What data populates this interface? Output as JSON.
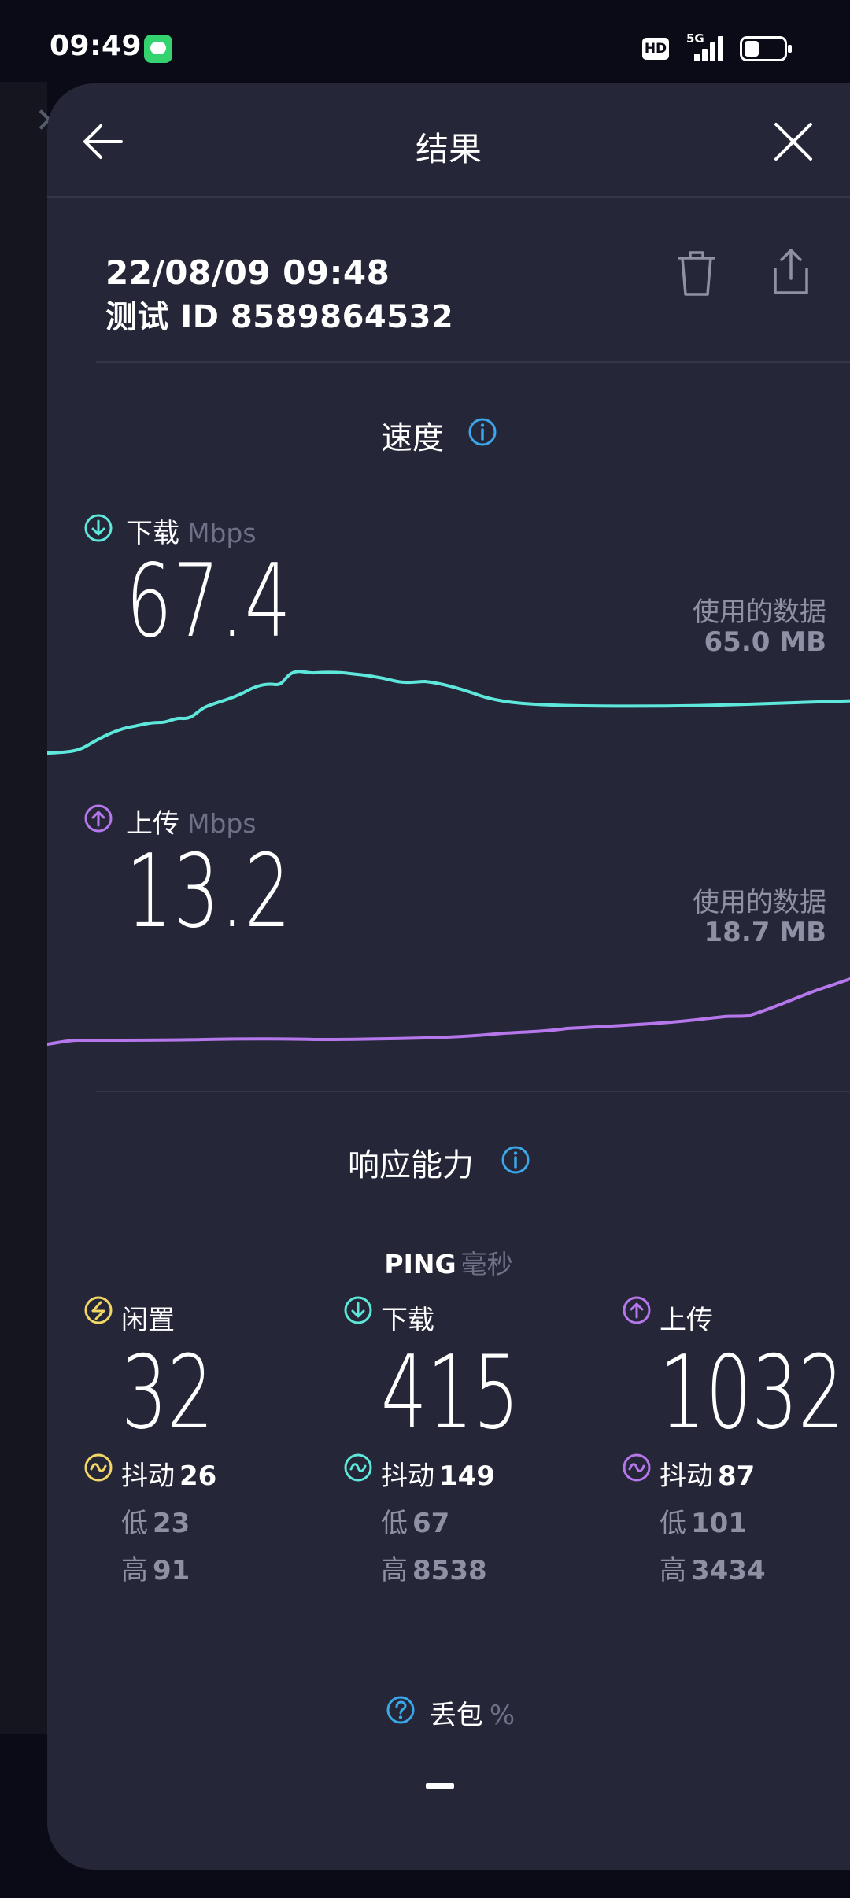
{
  "status_bar": {
    "time": "09:49",
    "hd": "HD",
    "network": "5G"
  },
  "header": {
    "title": "结果",
    "back_icon": "arrow-left-icon",
    "close_icon": "close-icon"
  },
  "result": {
    "date": "22/08/09 09:48",
    "test_id": "测试 ID 8589864532"
  },
  "speed": {
    "title": "速度",
    "download": {
      "label": "下载",
      "unit": "Mbps",
      "value": "67.4",
      "data_used_label": "使用的数据",
      "data_used": "65.0 MB",
      "color": "#5ee8dc"
    },
    "upload": {
      "label": "上传",
      "unit": "Mbps",
      "value": "13.2",
      "data_used_label": "使用的数据",
      "data_used": "18.7 MB",
      "color": "#b677ec"
    }
  },
  "responsiveness": {
    "title": "响应能力",
    "ping_label": "PING",
    "ping_unit": "毫秒",
    "columns": [
      {
        "label": "闲置",
        "value": "32",
        "jitter_label": "抖动",
        "jitter": "26",
        "low_label": "低",
        "low": "23",
        "high_label": "高",
        "high": "91",
        "color": "#f2d766"
      },
      {
        "label": "下载",
        "value": "415",
        "jitter_label": "抖动",
        "jitter": "149",
        "low_label": "低",
        "low": "67",
        "high_label": "高",
        "high": "8538",
        "color": "#5ee8dc"
      },
      {
        "label": "上传",
        "value": "1032",
        "jitter_label": "抖动",
        "jitter": "87",
        "low_label": "低",
        "low": "101",
        "high_label": "高",
        "high": "3434",
        "color": "#b677ec"
      }
    ]
  },
  "packet_loss": {
    "label": "丢包",
    "unit": "%",
    "value": "—"
  },
  "colors": {
    "background": "#0a0b16",
    "sheet": "#252738",
    "accent_blue": "#3aa7e8",
    "muted_text": "#8e90a4"
  }
}
